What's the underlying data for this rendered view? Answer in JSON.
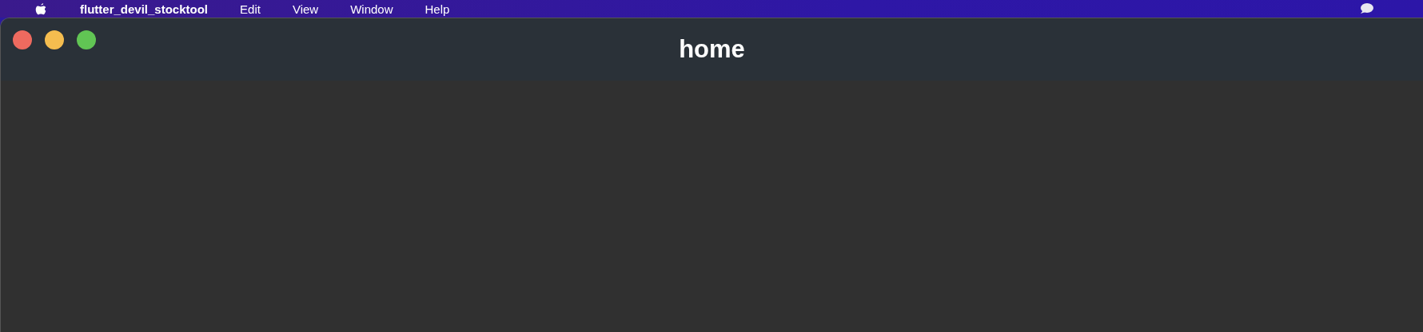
{
  "menu_bar": {
    "app_name": "flutter_devil_stocktool",
    "items": [
      "Edit",
      "View",
      "Window",
      "Help"
    ]
  },
  "window": {
    "title": "home",
    "buttons": [
      {
        "kind": "close"
      },
      {
        "kind": "minimize"
      },
      {
        "kind": "zoom"
      }
    ]
  }
}
